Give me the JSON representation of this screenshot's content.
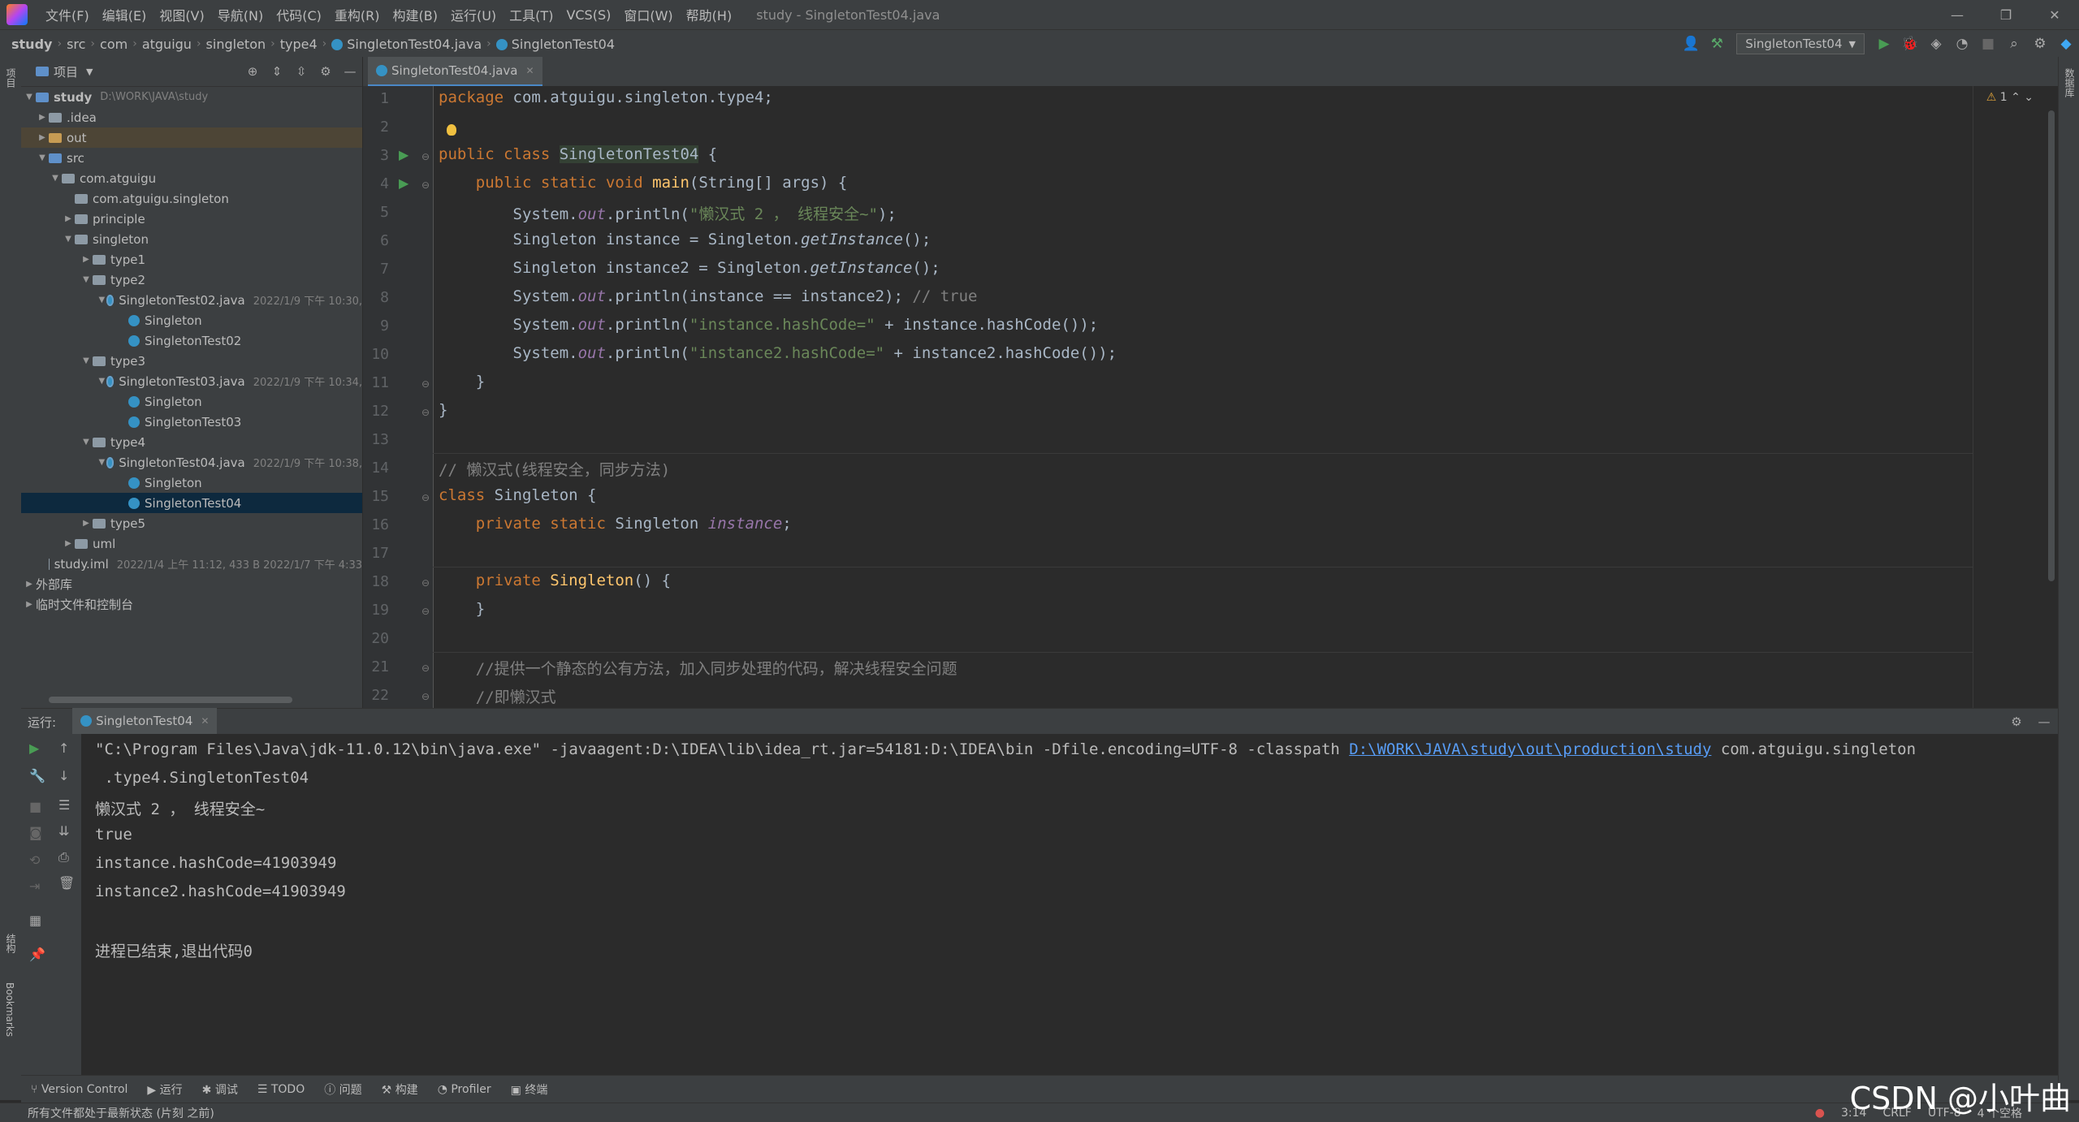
{
  "menubar": {
    "items": [
      "文件(F)",
      "编辑(E)",
      "视图(V)",
      "导航(N)",
      "代码(C)",
      "重构(R)",
      "构建(B)",
      "运行(U)",
      "工具(T)",
      "VCS(S)",
      "窗口(W)",
      "帮助(H)"
    ],
    "window_title": "study - SingletonTest04.java"
  },
  "navbar": {
    "crumbs": [
      "study",
      "src",
      "com",
      "atguigu",
      "singleton",
      "type4",
      "SingletonTest04.java",
      "SingletonTest04"
    ],
    "run_config": "SingletonTest04"
  },
  "left_strip": {
    "project": "项目",
    "structure": "结构",
    "bookmarks": "Bookmarks"
  },
  "right_strip": {
    "database": "数据库"
  },
  "project": {
    "header": "项目",
    "rows": [
      {
        "label": "study",
        "meta": "D:\\WORK\\JAVA\\study"
      },
      {
        "label": ".idea"
      },
      {
        "label": "out"
      },
      {
        "label": "src"
      },
      {
        "label": "com.atguigu"
      },
      {
        "label": "com.atguigu.singleton"
      },
      {
        "label": "principle"
      },
      {
        "label": "singleton"
      },
      {
        "label": "type1"
      },
      {
        "label": "type2"
      },
      {
        "label": "SingletonTest02.java",
        "meta": "2022/1/9 下午 10:30,"
      },
      {
        "label": "Singleton"
      },
      {
        "label": "SingletonTest02"
      },
      {
        "label": "type3"
      },
      {
        "label": "SingletonTest03.java",
        "meta": "2022/1/9 下午 10:34,"
      },
      {
        "label": "Singleton"
      },
      {
        "label": "SingletonTest03"
      },
      {
        "label": "type4"
      },
      {
        "label": "SingletonTest04.java",
        "meta": "2022/1/9 下午 10:38,"
      },
      {
        "label": "Singleton"
      },
      {
        "label": "SingletonTest04"
      },
      {
        "label": "type5"
      },
      {
        "label": "uml"
      },
      {
        "label": "study.iml",
        "meta": "2022/1/4 上午 11:12, 433 B 2022/1/7 下午 4:33"
      },
      {
        "label": "外部库"
      },
      {
        "label": "临时文件和控制台"
      }
    ]
  },
  "editor": {
    "tab": "SingletonTest04.java",
    "warnings": "1",
    "line_numbers": [
      "1",
      "2",
      "3",
      "4",
      "5",
      "6",
      "7",
      "8",
      "9",
      "10",
      "11",
      "12",
      "13",
      "14",
      "15",
      "16",
      "17",
      "18",
      "19",
      "20",
      "21",
      "22"
    ]
  },
  "run": {
    "label": "运行:",
    "tab": "SingletonTest04",
    "cmd_line1": "\"C:\\Program Files\\Java\\jdk-11.0.12\\bin\\java.exe\" -javaagent:D:\\IDEA\\lib\\idea_rt.jar=54181:D:\\IDEA\\bin -Dfile.encoding=UTF-8 -classpath ",
    "cmd_link": "D:\\WORK\\JAVA\\study\\out\\production\\study",
    "cmd_tail": " com.atguigu.singleton",
    "cmd_line2": " .type4.SingletonTest04",
    "out1": "懒汉式 2 ， 线程安全~",
    "out2": "true",
    "out3": "instance.hashCode=41903949",
    "out4": "instance2.hashCode=41903949",
    "exit": "进程已结束,退出代码0"
  },
  "bottom_tools": [
    "Version Control",
    "运行",
    "调试",
    "TODO",
    "问题",
    "构建",
    "Profiler",
    "终端"
  ],
  "status": {
    "message": "所有文件都处于最新状态 (片刻 之前)",
    "position": "3:14",
    "line_sep": "CRLF",
    "encoding": "UTF-8",
    "indent": "4 个空格"
  },
  "watermark": "CSDN @小叶曲"
}
